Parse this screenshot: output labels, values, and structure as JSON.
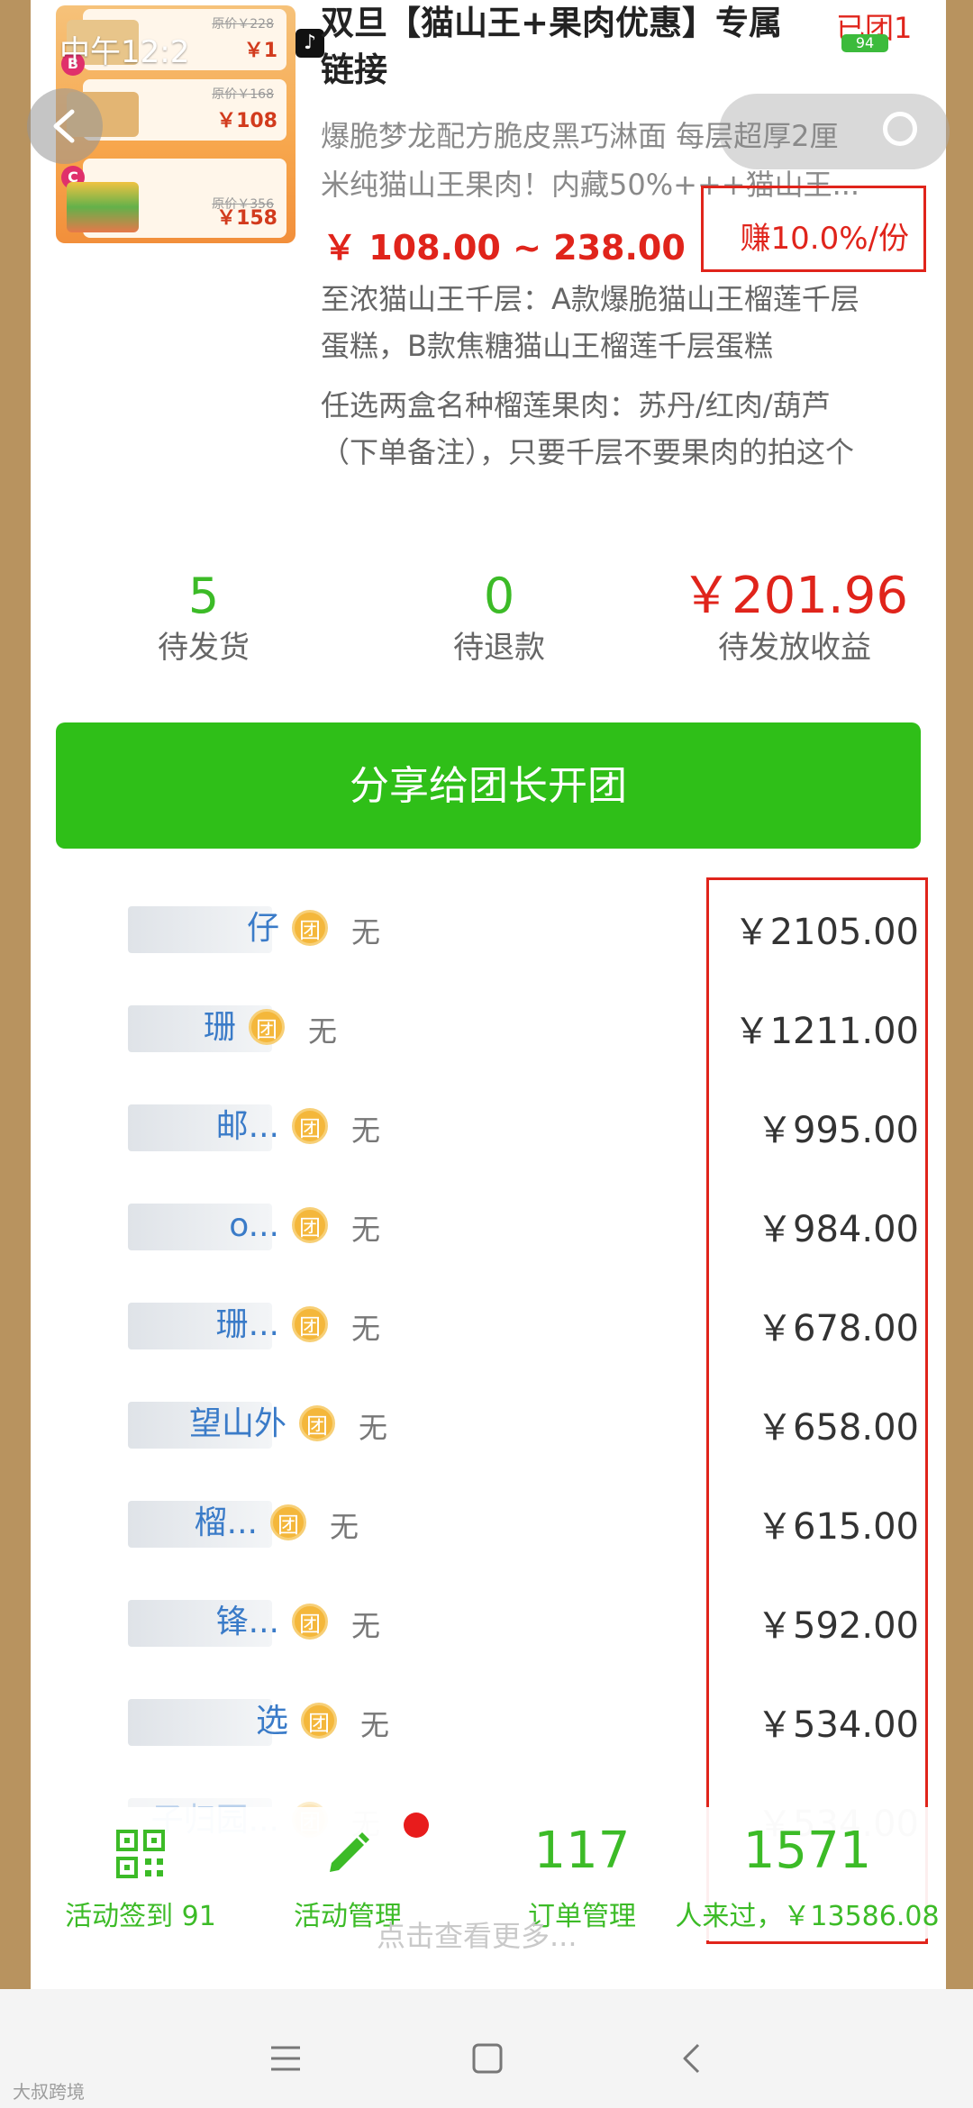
{
  "status_bar": {
    "time": "中午12:2",
    "battery": "94"
  },
  "product": {
    "title_line1": "双旦【猫山王+果肉优惠】专属",
    "title_line2": "链接",
    "group_state": "已团1",
    "desc_line1": "爆脆梦龙配方脆皮黑巧淋面 每层超厚2厘",
    "desc_line2": "米纯猫山王果肉！内藏50%+++猫山王...",
    "price_range": "￥ 108.00 ~ 238.00",
    "earn": "赚10.0%/份",
    "spec1_line1": "至浓猫山王千层：A款爆脆猫山王榴莲千层",
    "spec1_line2": "蛋糕，B款焦糖猫山王榴莲千层蛋糕",
    "spec2_line1": "任选两盒名种榴莲果肉：苏丹/红肉/葫芦",
    "spec2_line2": "（下单备注），只要千层不要果肉的拍这个",
    "thumb": {
      "card_a_old": "原价￥228",
      "card_a_price": "￥1",
      "card_b_badge": "B",
      "card_b_old": "原价￥168",
      "card_b_price": "￥108",
      "card_c_badge": "C",
      "card_c_old": "原价￥356",
      "card_c_price": "￥158"
    }
  },
  "stats": [
    {
      "value": "5",
      "label": "待发货"
    },
    {
      "value": "0",
      "label": "待退款"
    },
    {
      "value": "￥201.96",
      "label": "待发放收益"
    }
  ],
  "share_button": "分享给团长开团",
  "list": {
    "rows": [
      {
        "name": "仔",
        "tag": "团",
        "status": "无",
        "amount": "￥2105.00"
      },
      {
        "name": "珊",
        "tag": "团",
        "status": "无",
        "amount": "￥1211.00"
      },
      {
        "name": "邮...",
        "tag": "团",
        "status": "无",
        "amount": "￥995.00"
      },
      {
        "name": "o...",
        "tag": "团",
        "status": "无",
        "amount": "￥984.00"
      },
      {
        "name": "珊...",
        "tag": "团",
        "status": "无",
        "amount": "￥678.00"
      },
      {
        "name": "望山外",
        "tag": "团",
        "status": "无",
        "amount": "￥658.00"
      },
      {
        "name": "榴...",
        "tag": "团",
        "status": "无",
        "amount": "￥615.00"
      },
      {
        "name": "锋...",
        "tag": "团",
        "status": "无",
        "amount": "￥592.00"
      },
      {
        "name": "选",
        "tag": "团",
        "status": "无",
        "amount": "￥534.00"
      },
      {
        "name": "子归园...",
        "tag": "团",
        "status": "无",
        "amount": "￥534.00"
      }
    ],
    "more_link": "点击查看更多..."
  },
  "bottom_bar": {
    "checkin_label": "活动签到 91",
    "manage_label": "活动管理",
    "orders_count": "117",
    "orders_label": "订单管理",
    "visitors_count": "1571",
    "visitors_label": "人来过，￥13586.08"
  },
  "watermark": "大叔跨境",
  "colors": {
    "accent_green": "#3cbb27",
    "alert_red": "#e0241b",
    "side_brown": "#b8935f"
  }
}
